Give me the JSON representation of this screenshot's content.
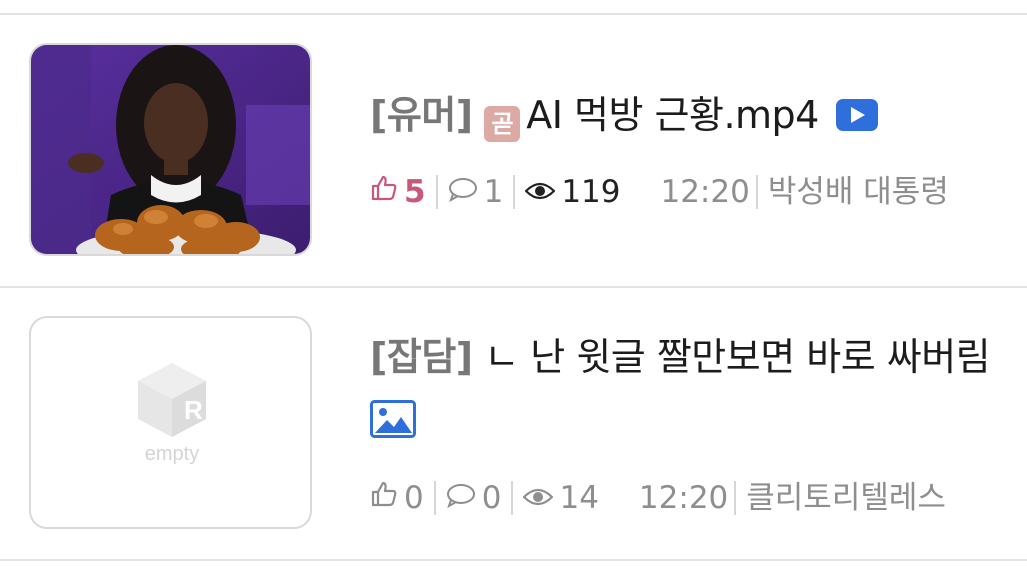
{
  "posts": [
    {
      "category": "[유머]",
      "badge": "곧",
      "title": "AI 먹방 근황.mp4",
      "has_video": true,
      "likes": "5",
      "comments": "1",
      "views": "119",
      "time": "12:20",
      "author": "박성배 대통령"
    },
    {
      "category": "[잡담]",
      "title": "ㄴ 난 윗글 짤만보면 바로 싸버림",
      "has_image": true,
      "likes": "0",
      "comments": "0",
      "views": "14",
      "time": "12:20",
      "author": "클리토리텔레스",
      "thumbnail_placeholder": "empty"
    }
  ],
  "colors": {
    "like_active": "#c9577a",
    "meta_gray": "#8e8e8e",
    "video_badge": "#2f6fdb",
    "divider": "#e3e3e3"
  },
  "icons": [
    "thumbs-up-icon",
    "comment-icon",
    "eye-icon",
    "video-play-icon",
    "image-icon",
    "gold-badge-icon"
  ]
}
